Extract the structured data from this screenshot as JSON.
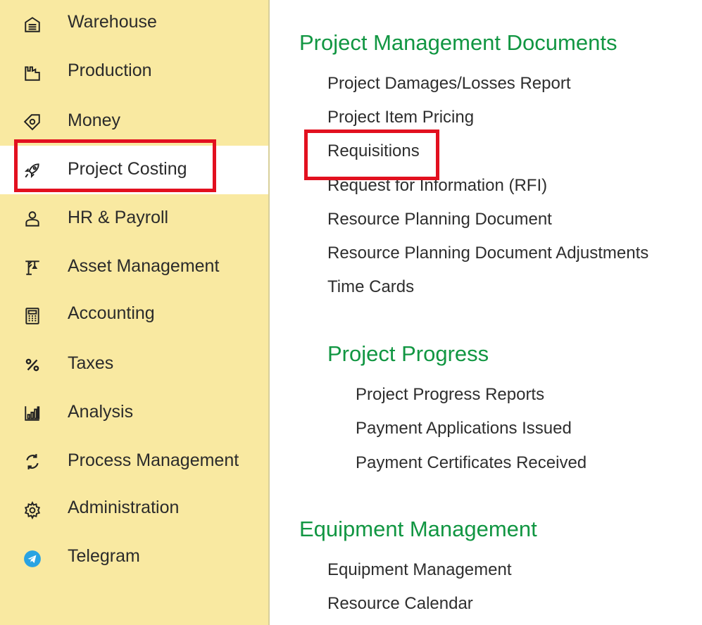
{
  "sidebar": {
    "items": [
      {
        "label": "Warehouse",
        "icon": "warehouse-icon"
      },
      {
        "label": "Production",
        "icon": "production-icon"
      },
      {
        "label": "Money",
        "icon": "money-icon"
      },
      {
        "label": "Project Costing",
        "icon": "rocket-icon",
        "active": true
      },
      {
        "label": "HR & Payroll",
        "icon": "person-icon"
      },
      {
        "label": "Asset Management",
        "icon": "crane-icon"
      },
      {
        "label": "Accounting",
        "icon": "calculator-icon"
      },
      {
        "label": "Taxes",
        "icon": "percent-icon"
      },
      {
        "label": "Analysis",
        "icon": "bar-chart-icon"
      },
      {
        "label": "Process Management",
        "icon": "refresh-icon"
      },
      {
        "label": "Administration",
        "icon": "gear-icon"
      },
      {
        "label": "Telegram",
        "icon": "telegram-icon"
      }
    ]
  },
  "main": {
    "pm_docs": {
      "title": "Project Management Documents",
      "links": [
        "Project Damages/Losses Report",
        "Project Item Pricing",
        "Requisitions",
        "Request for Information (RFI)",
        "Resource Planning Document",
        "Resource Planning Document Adjustments",
        "Time Cards"
      ]
    },
    "progress": {
      "title": "Project Progress",
      "links": [
        "Project Progress Reports",
        "Payment Applications Issued",
        "Payment Certificates Received"
      ]
    },
    "equipment": {
      "title": "Equipment Management",
      "links": [
        "Equipment Management",
        "Resource Calendar"
      ]
    }
  },
  "colors": {
    "sidebar_bg": "#f9e9a1",
    "section_title": "#119642",
    "highlight": "#e2101f",
    "telegram": "#2aa3e2"
  }
}
